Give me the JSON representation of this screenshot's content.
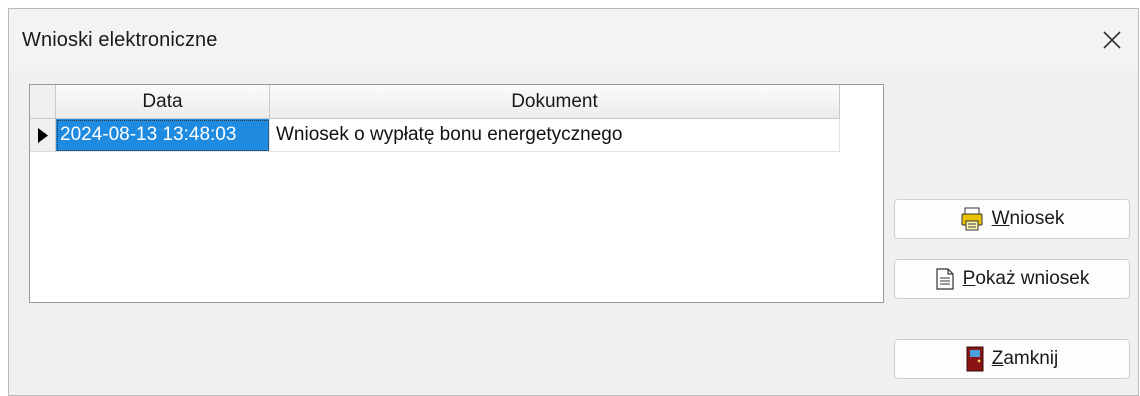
{
  "window": {
    "title": "Wnioski elektroniczne"
  },
  "grid": {
    "columns": [
      "Data",
      "Dokument"
    ],
    "rows": [
      {
        "data": "2024-08-13 13:48:03",
        "dokument": "Wniosek o wypłatę bonu energetycznego"
      }
    ]
  },
  "buttons": {
    "wniosek": {
      "accel": "W",
      "rest": "niosek"
    },
    "pokaz": {
      "accel": "P",
      "rest": "okaż wniosek"
    },
    "zamknij": {
      "accel": "Z",
      "rest": "amknij"
    }
  },
  "icons": {
    "close": "close-icon",
    "row_pointer": "row-pointer-icon",
    "wniosek": "printer-icon",
    "pokaz": "document-icon",
    "zamknij": "door-icon"
  },
  "colors": {
    "selection": "#1e8ae0",
    "door": "#8a1414",
    "printer": "#e8c200"
  }
}
